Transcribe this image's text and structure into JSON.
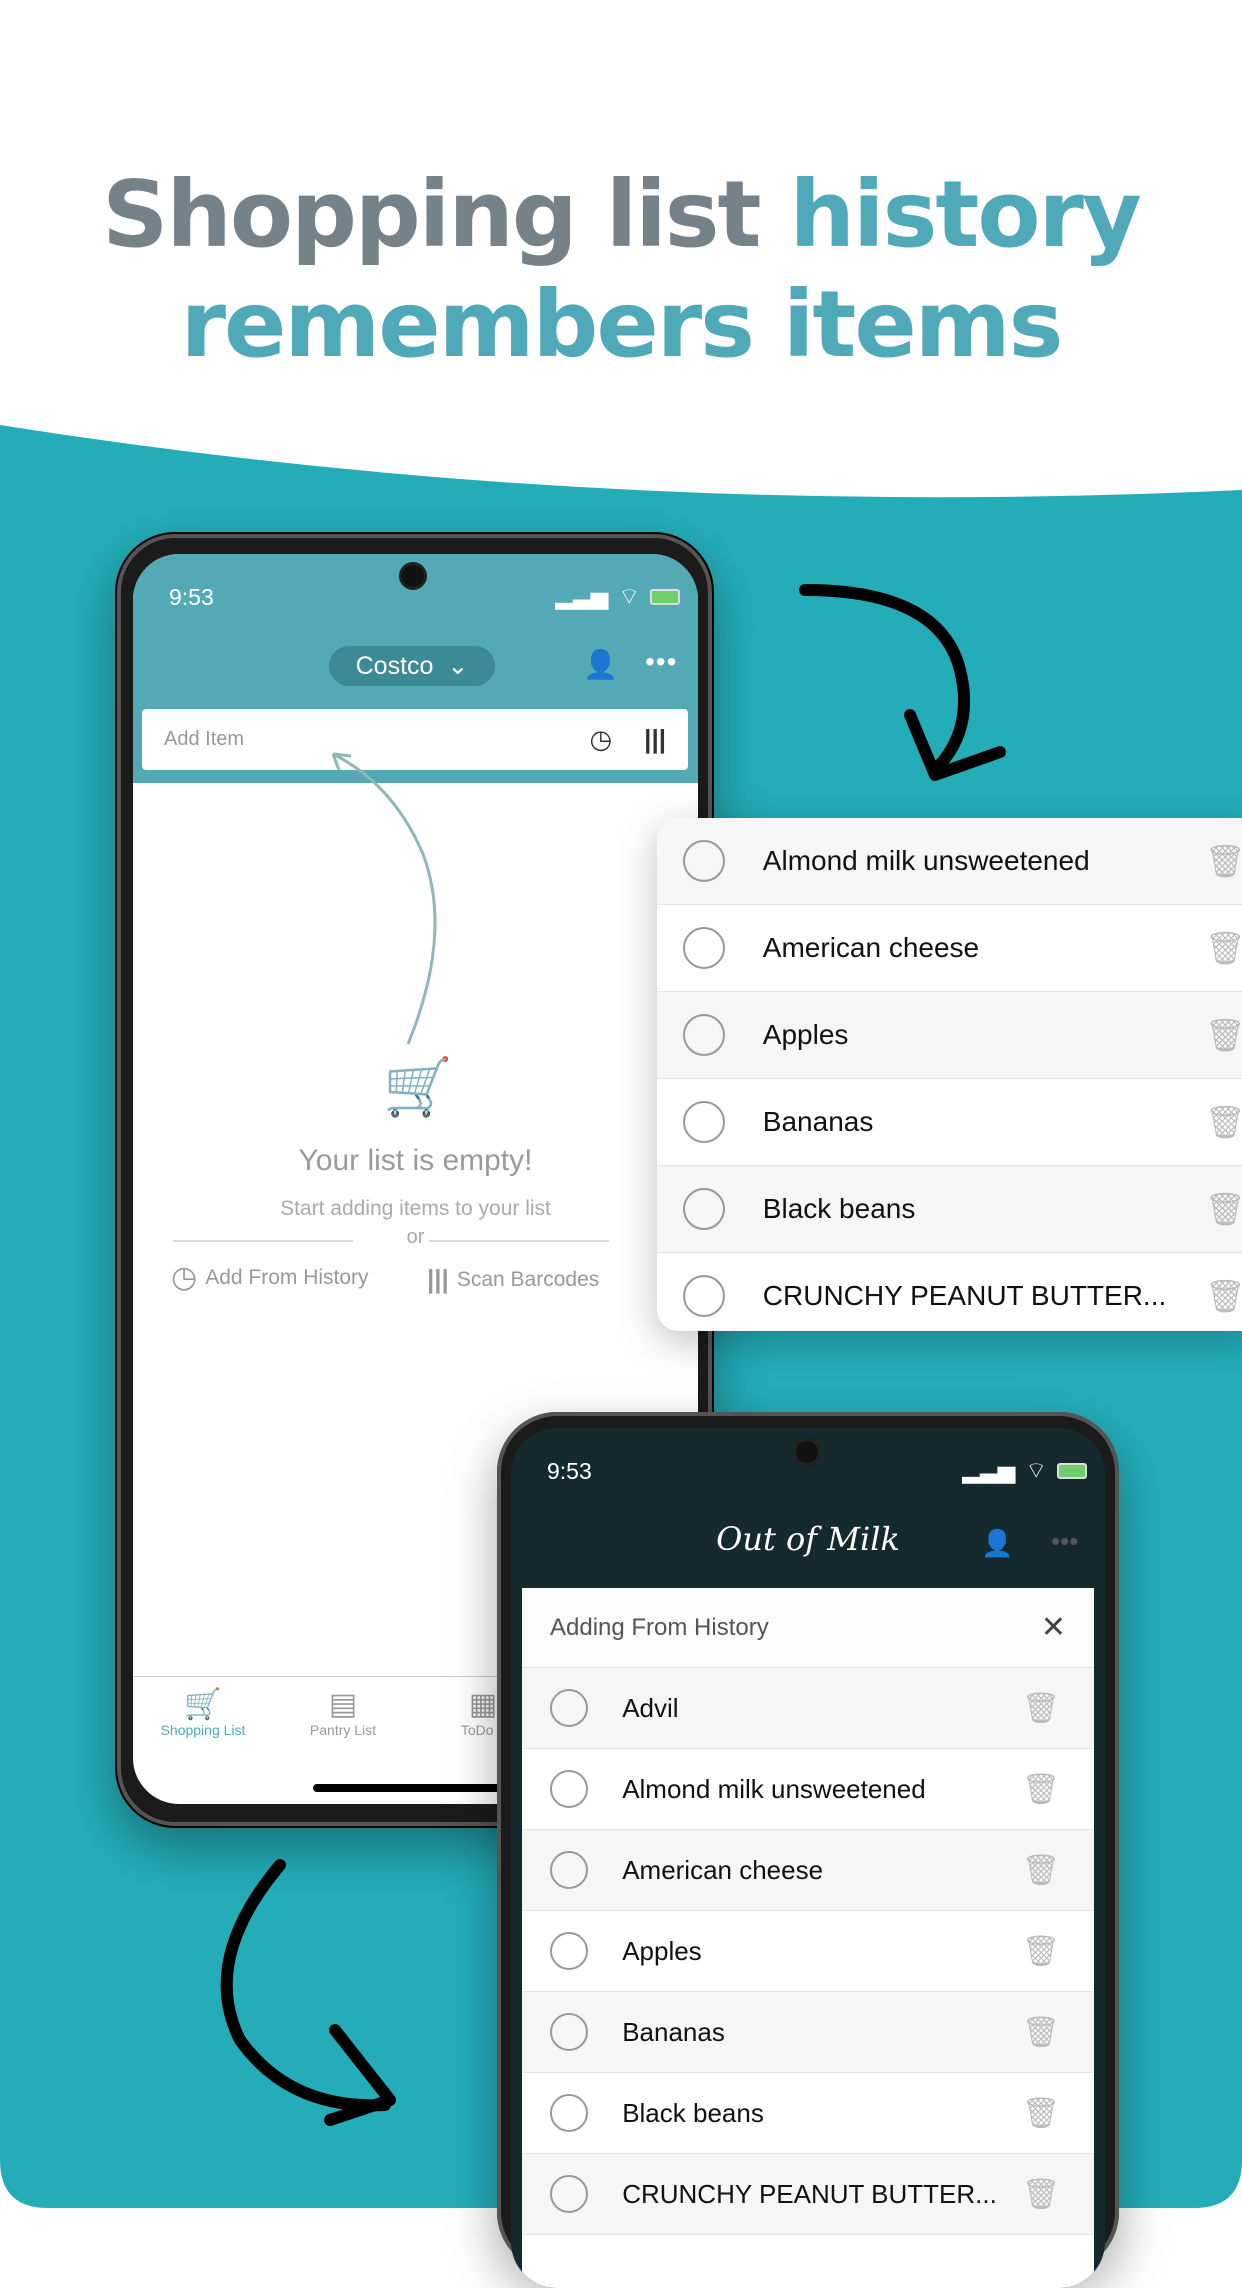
{
  "headline": {
    "line1_gray": "Shopping list ",
    "line1_teal": "history",
    "line2_teal": "remembers items"
  },
  "colors": {
    "background_teal": "#24adb9",
    "header_teal": "#54a9b7",
    "dark_header": "#152a2e",
    "headline_gray": "#76828a",
    "headline_teal": "#4fa9b8"
  },
  "phone1": {
    "time": "9:53",
    "list_selector": "Costco",
    "add_item_placeholder": "Add Item",
    "empty_title": "Your list is empty!",
    "empty_subtitle": "Start adding items to your list",
    "or": "or",
    "add_from_history": "Add From History",
    "scan_barcodes": "Scan Barcodes",
    "tabs": [
      {
        "label": "Shopping List",
        "icon": "cart-icon",
        "active": true
      },
      {
        "label": "Pantry List",
        "icon": "jar-icon",
        "active": false
      },
      {
        "label": "ToDo L",
        "icon": "todo-icon",
        "active": false
      }
    ]
  },
  "floating_card": {
    "items": [
      "Almond milk unsweetened",
      "American cheese",
      "Apples",
      "Bananas",
      "Black beans",
      "CRUNCHY PEANUT BUTTER..."
    ]
  },
  "phone2": {
    "time": "9:53",
    "logo": "Out of Milk",
    "modal_title": "Adding From History",
    "items": [
      "Advil",
      "Almond milk unsweetened",
      "American cheese",
      "Apples",
      "Bananas",
      "Black beans",
      "CRUNCHY PEANUT BUTTER..."
    ]
  }
}
